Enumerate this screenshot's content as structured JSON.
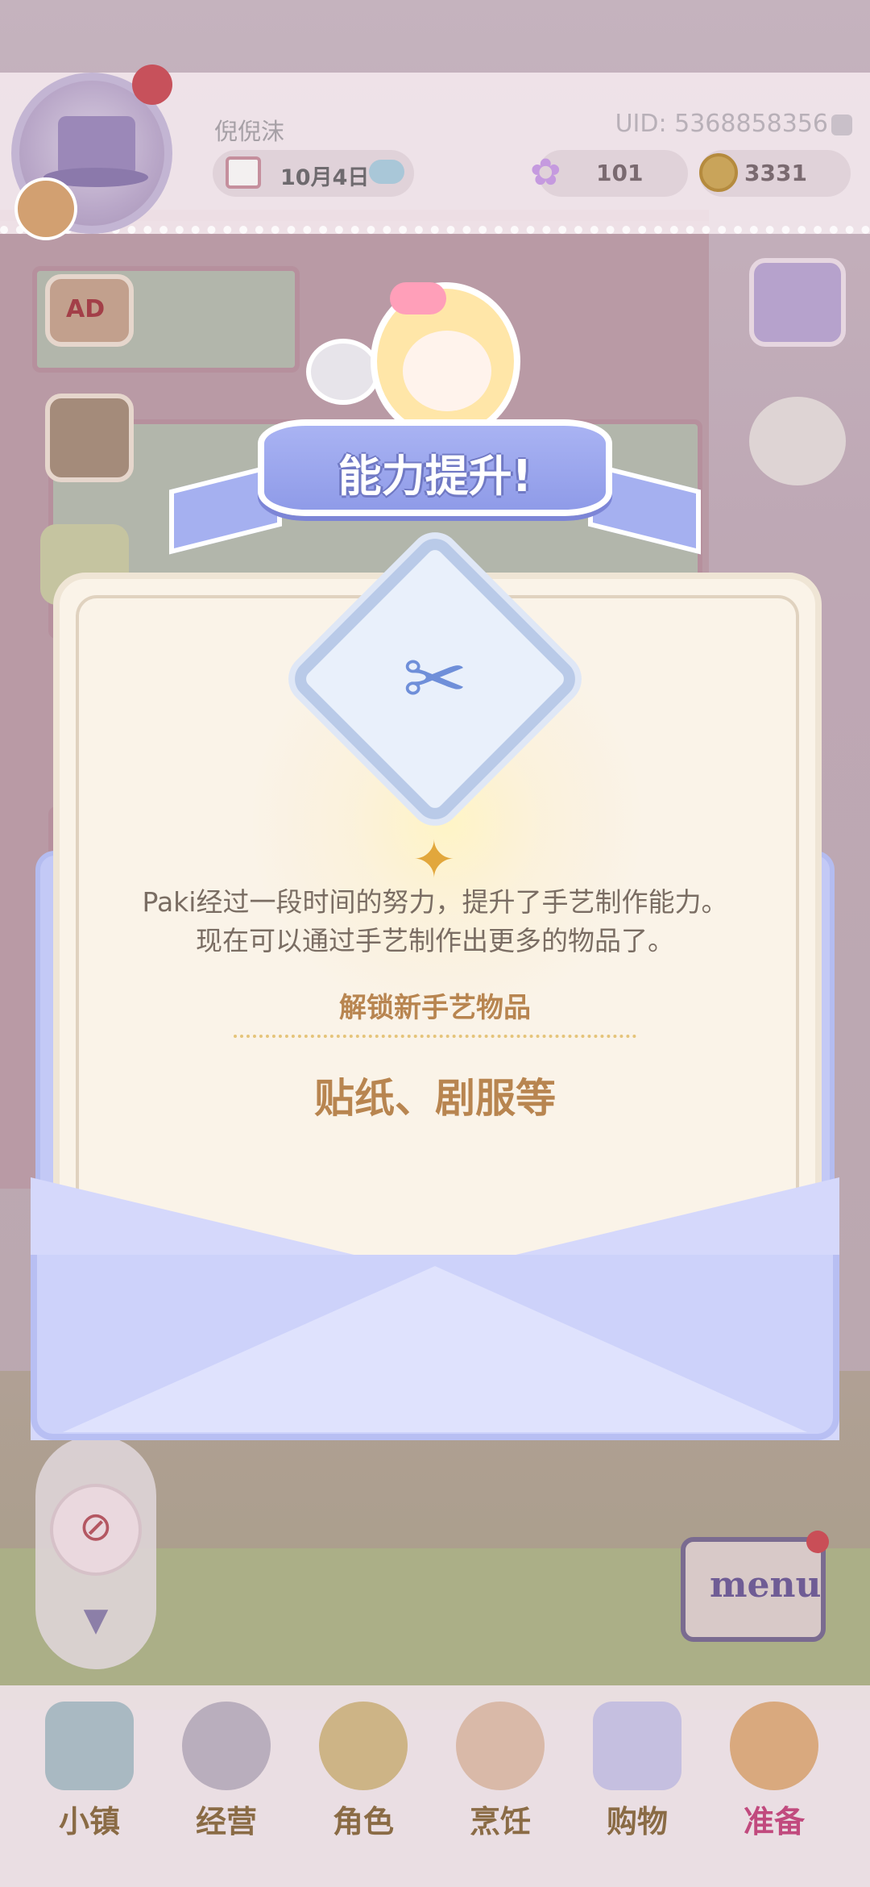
{
  "header": {
    "player_name": "倪倪沫",
    "uid": "UID: 5368858356",
    "date": "10月4日",
    "gems": "101",
    "coins": "3331"
  },
  "side": {
    "ad_label": "AD",
    "menu_label": "menu"
  },
  "modal": {
    "banner_title": "能力提升!",
    "description_line1": "Paki经过一段时间的努力，提升了手艺制作能力。",
    "description_line2": "现在可以通过手艺制作出更多的物品了。",
    "unlock_title": "解锁新手艺物品",
    "unlock_items": "贴纸、剧服等"
  },
  "nav": {
    "items": [
      {
        "label": "小镇",
        "icon": "map-icon"
      },
      {
        "label": "经营",
        "icon": "locked-shop-icon"
      },
      {
        "label": "角色",
        "icon": "character-icon"
      },
      {
        "label": "烹饪",
        "icon": "sandwich-icon"
      },
      {
        "label": "购物",
        "icon": "shopping-bag-icon"
      },
      {
        "label": "准备",
        "icon": "basket-icon"
      }
    ],
    "active_index": 5
  },
  "colors": {
    "ribbon": "#9aa5ee",
    "card": "#faf3e8",
    "accent_text": "#b88550",
    "active_nav": "#c14a7e"
  }
}
